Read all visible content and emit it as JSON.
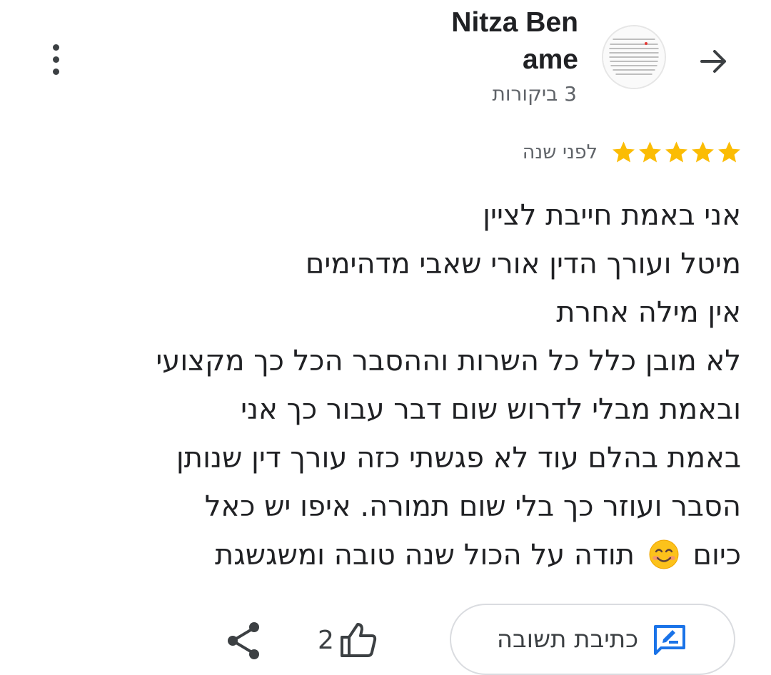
{
  "reviewer": {
    "name": "Nitza Ben ame",
    "review_count": "3 ביקורות"
  },
  "review": {
    "rating": 5,
    "date": "לפני שנה",
    "lines": [
      "אני באמת חייבת לציין",
      "מיטל ועורך הדין אורי שאבי מדהימים",
      "אין מילה אחרת",
      "לא מובן כלל כל השרות וההסבר הכל כך מקצועי",
      "ובאמת מבלי לדרוש שום דבר עבור כך אני",
      "באמת בהלם עוד לא פגשתי כזה עורך דין שנותן",
      "הסבר ועוזר כך בלי שום תמורה. איפו יש כאל"
    ],
    "last_line_start": "כיום",
    "last_line_end": "תודה על הכול שנה טובה ומשגשגת",
    "emoji": "smiling-face-emoji"
  },
  "actions": {
    "reply_label": "כתיבת תשובה",
    "like_count": "2"
  },
  "icons": {
    "back": "arrow-right-icon",
    "more": "more-vert-icon",
    "star": "star-icon",
    "reply": "rate-review-icon",
    "like": "thumb-up-icon",
    "share": "share-icon"
  },
  "colors": {
    "star": "#fbbc04",
    "reply_icon": "#1a73e8",
    "text_primary": "#202124",
    "text_secondary": "#5f6368"
  }
}
